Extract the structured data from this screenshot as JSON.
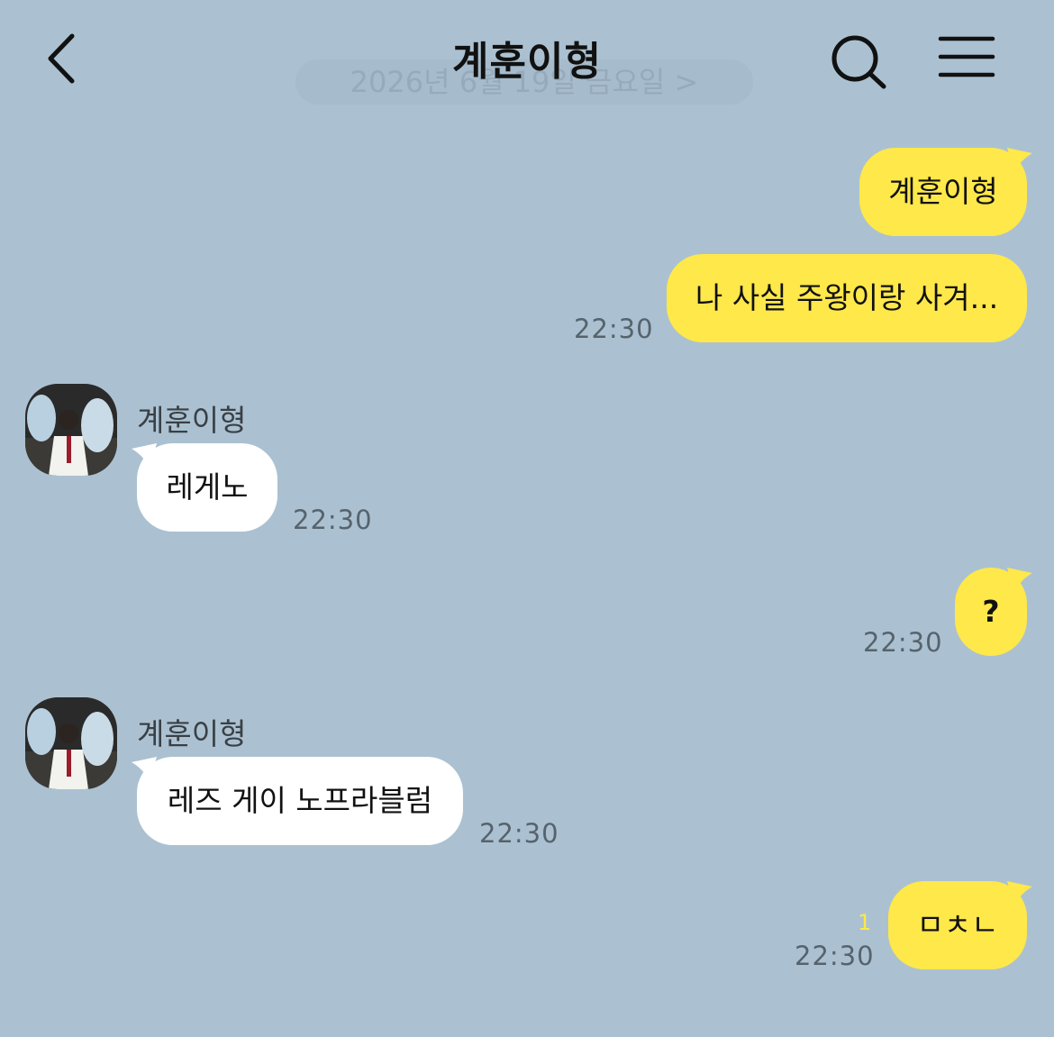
{
  "header": {
    "title": "계훈이형",
    "date_divider": "2026년 6월 19일 금요일 >"
  },
  "colors": {
    "background": "#abc1d1",
    "my_bubble": "#fee84a",
    "their_bubble": "#ffffff",
    "unread": "#fee84a"
  },
  "icons": {
    "back": "chevron-left-icon",
    "search": "search-icon",
    "menu": "hamburger-menu-icon"
  },
  "messages": [
    {
      "from": "me",
      "text": "계훈이형"
    },
    {
      "from": "me",
      "text": "나 사실 주왕이랑 사겨...",
      "time": "22:30"
    },
    {
      "from": "them",
      "sender": "계훈이형",
      "text": "레게노",
      "time": "22:30"
    },
    {
      "from": "me",
      "text": "?",
      "time": "22:30"
    },
    {
      "from": "them",
      "sender": "계훈이형",
      "text": "레즈 게이 노프라블럼",
      "time": "22:30"
    },
    {
      "from": "me",
      "text": "ㅁㅊㄴ",
      "time": "22:30",
      "unread": "1"
    }
  ]
}
